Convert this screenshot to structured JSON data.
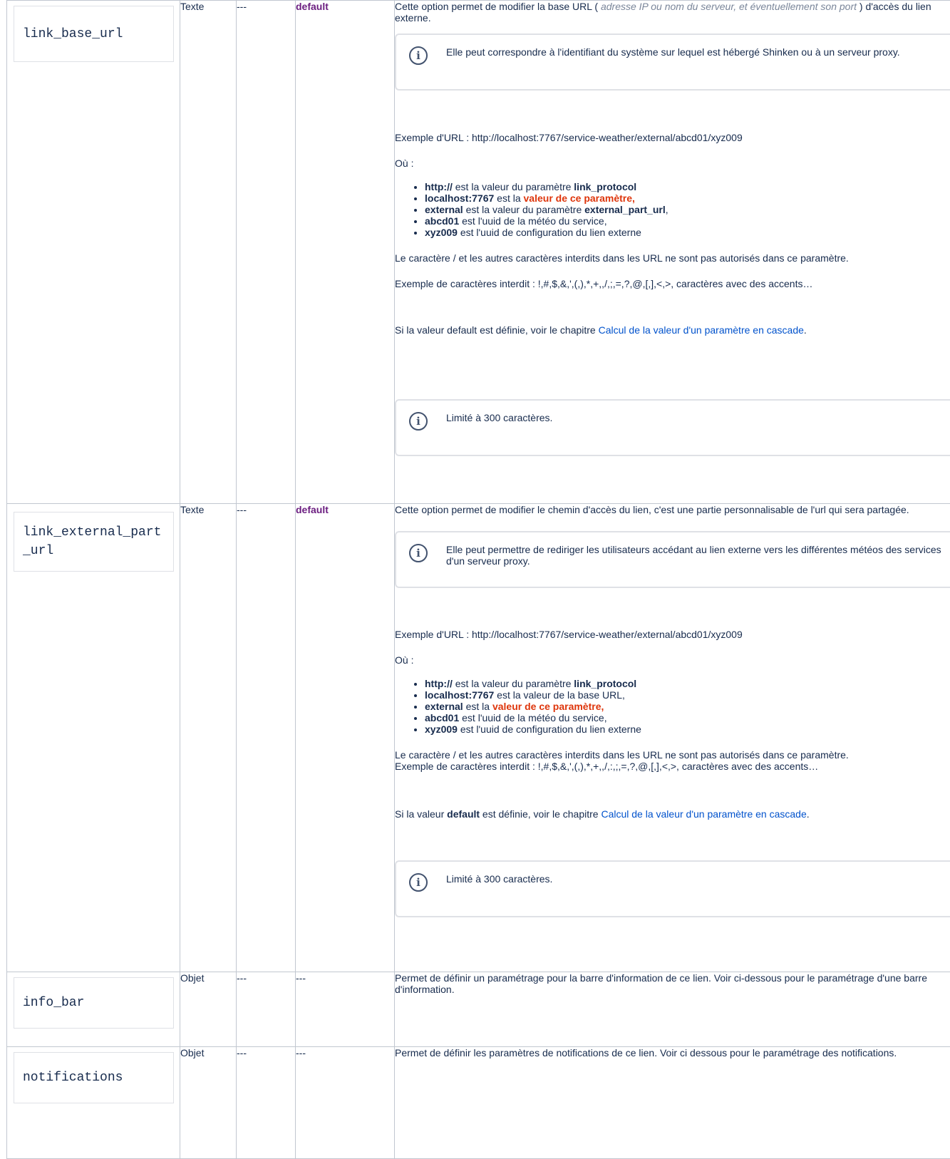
{
  "rows": [
    {
      "name": "link_base_url",
      "type": "Texte",
      "dash": "---",
      "default": "default",
      "intro_a": "Cette option permet de modifier la base URL  ( ",
      "intro_hint": "adresse IP ou nom du serveur, et éventuellement son port",
      "intro_b": " ) d'accès du lien externe.",
      "info": "Elle peut correspondre à l'identifiant du système sur lequel est hébergé Shinken ou à un serveur proxy.",
      "example": "Exemple d'URL : http://localhost:7767/service-weather/external/abcd01/xyz009",
      "ou": "Où :",
      "bullets": [
        {
          "b": "http://",
          "t": " est la valeur du paramètre ",
          "b2": "link_protocol",
          "t2": "",
          "red": ""
        },
        {
          "b": "localhost:7767",
          "t": " est la ",
          "b2": "",
          "t2": "",
          "red": "valeur de ce paramètre,"
        },
        {
          "b": "external",
          "t": " est la valeur du paramètre ",
          "b2": "external_part_url",
          "t2": ",",
          "red": ""
        },
        {
          "b": "abcd01",
          "t": " est l'uuid de la météo du service,",
          "b2": "",
          "t2": "",
          "red": ""
        },
        {
          "b": "xyz009",
          "t": " est l'uuid de configuration du lien externe",
          "b2": "",
          "t2": "",
          "red": ""
        }
      ],
      "forbidden1": "Le caractère / et les autres caractères interdits dans les URL ne sont pas autorisés dans ce paramètre.",
      "forbidden2": "Exemple de caractères interdit : !,#,$,&,',(,),*,+,,/,;,=,?,@,[,],<,>, caractères avec des accents…",
      "default_a": "Si la valeur default est définie, voir le chapitre ",
      "default_link": "Calcul de la valeur d'un paramètre en cascade",
      "default_b": ".",
      "limit": "Limité à 300 caractères."
    },
    {
      "name": "link_external_part_url",
      "type": "Texte",
      "dash": "---",
      "default": "default",
      "intro": "Cette option permet de modifier le chemin d'accès du lien, c'est une partie personnalisable de l'url qui sera partagée.",
      "info": "Elle peut permettre de rediriger les utilisateurs accédant au lien externe vers les différentes météos des services d'un serveur proxy.",
      "example": "Exemple d'URL : http://localhost:7767/service-weather/external/abcd01/xyz009",
      "ou": "Où :",
      "bullets": [
        {
          "b": "http://",
          "t": " est la valeur du paramètre ",
          "b2": "link_protocol",
          "red": ""
        },
        {
          "b": "localhost:7767",
          "t": " est la valeur de la base URL,",
          "b2": "",
          "red": ""
        },
        {
          "b": "external",
          "t": " est la ",
          "b2": "",
          "red": "valeur de ce paramètre,"
        },
        {
          "b": "abcd01",
          "t": " est l'uuid de la météo du service,",
          "b2": "",
          "red": ""
        },
        {
          "b": "xyz009",
          "t": " est l'uuid de configuration du lien externe",
          "b2": "",
          "red": ""
        }
      ],
      "forbidden1": "Le caractère / et les autres caractères interdits dans les URL ne sont pas autorisés dans ce paramètre.",
      "forbidden2": "Exemple de caractères interdit : !,#,$,&,',(,),*,+,,/,:,;,=,?,@,[,],<,>, caractères avec des accents…",
      "default_a": "Si la valeur ",
      "default_bold": "default",
      "default_mid": " est définie, voir le chapitre ",
      "default_link": "Calcul de la valeur d'un paramètre en cascade",
      "default_b": ".",
      "limit": "Limité à 300 caractères."
    },
    {
      "name": "info_bar",
      "type": "Objet",
      "dash": "---",
      "default": "---",
      "desc": "Permet de définir un paramétrage pour la barre d'information de ce lien. Voir ci-dessous pour le paramétrage d'une barre d'information."
    },
    {
      "name": "notifications",
      "type": "Objet",
      "dash": "---",
      "default": "---",
      "desc": "Permet de définir les paramètres de notifications de ce lien. Voir ci dessous pour le paramétrage des notifications."
    }
  ]
}
